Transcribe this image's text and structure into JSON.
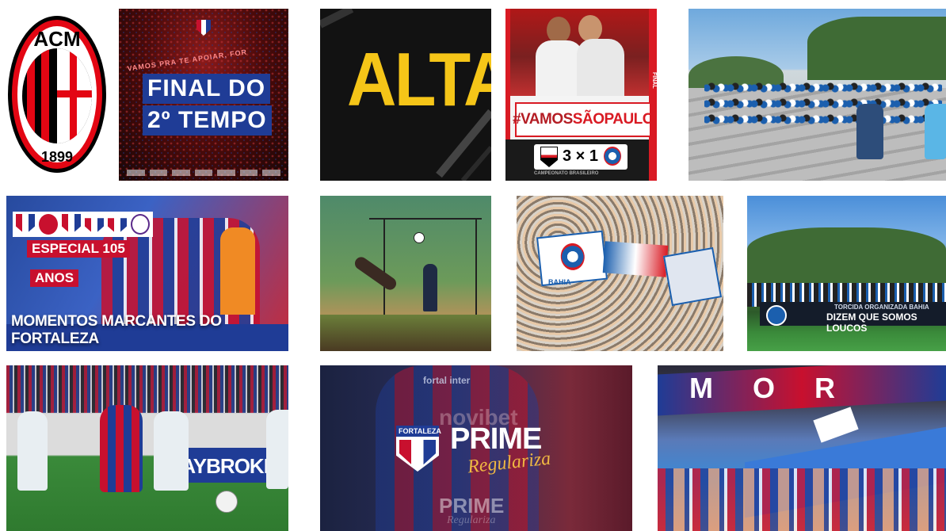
{
  "tiles": {
    "t1": {
      "top": "ACM",
      "year": "1899"
    },
    "t2": {
      "line1": "FINAL DO",
      "line2": "2º TEMPO",
      "banner": "VAMOS PRA TE APOIAR, FOR"
    },
    "t3": {
      "word": "ALTA"
    },
    "t4": {
      "tag_prefix": "#VAMOS",
      "tag_suffix": "SÃOPAULO",
      "score": "3 × 1",
      "side_label": "FINAL",
      "team_home": "SPFC",
      "competition": "CAMPEONATO BRASILEIRO"
    },
    "t6": {
      "badges": [
        "E",
        "FEC",
        "",
        "FORTALEZA",
        "FORTALEZA",
        "FC"
      ],
      "line1": "ESPECIAL 105",
      "line2": "ANOS",
      "bottom": "MOMENTOS MARCANTES DO FORTALEZA"
    },
    "t8": {
      "flag_text": "BAHIA"
    },
    "t9": {
      "banner1": "TORCIDA ORGANIZADA BAHIA",
      "banner2": "DIZEM QUE SOMOS LOUCOS"
    },
    "t10": {
      "board": "PAYBROKERS"
    },
    "t11": {
      "brand": "FORTALEZA",
      "prime": "PRIME",
      "regulariza": "Regulariza",
      "shirt_sponsor": "novibet",
      "shirt_top": "fortal  inter",
      "prime2": "PRIME",
      "regulariza2": "Regulariza"
    },
    "t12": {
      "banner": "M O R"
    }
  },
  "colors": {
    "fortaleza_red": "#c8102e",
    "fortaleza_blue": "#1f3c96",
    "alta_yellow": "#f5c518",
    "milan_red": "#e30613",
    "spfc_red": "#d91a23",
    "bahia_blue": "#1b5fae"
  }
}
